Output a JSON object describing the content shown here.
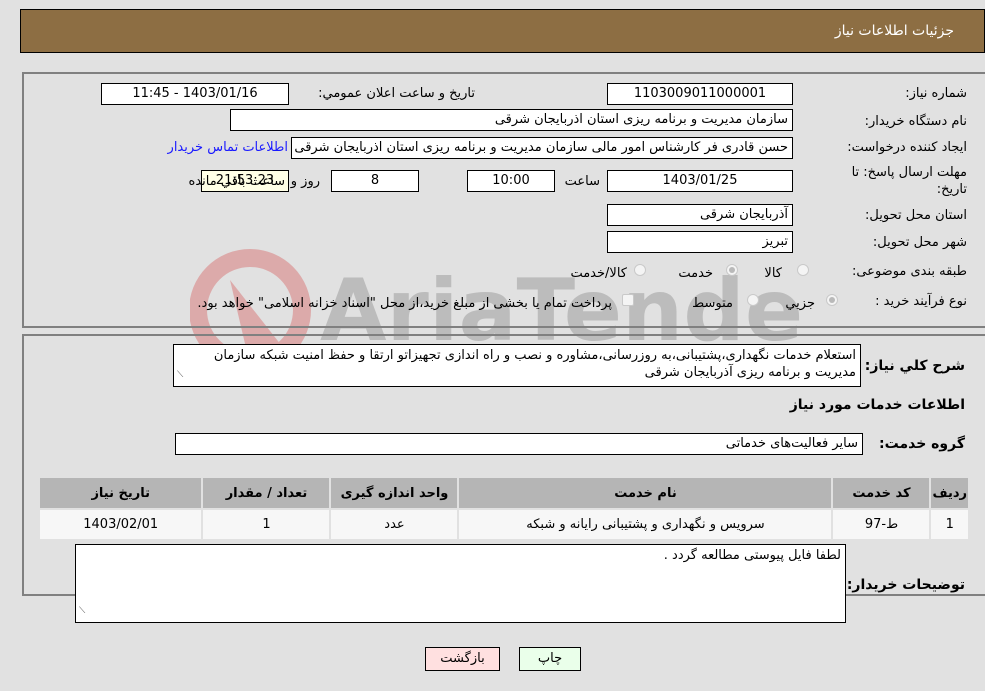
{
  "header": {
    "title": "جزئیات اطلاعات نیاز"
  },
  "fields": {
    "need_number": {
      "label": "شماره نیاز:",
      "value": "1103009011000001"
    },
    "announce_datetime": {
      "label": "تاریخ و ساعت اعلان عمومي:",
      "value": "1403/01/16 - 11:45"
    },
    "buyer_org": {
      "label": "نام دستگاه خريدار:",
      "value": "سازمان مدیریت و برنامه ریزی استان اذربایجان شرقی"
    },
    "requester": {
      "label": "ايجاد کننده درخواست:",
      "value": "حسن قادری فر کارشناس امور مالی سازمان مدیریت و برنامه ریزی استان اذربایجان شرقی"
    },
    "buyer_contact_link": "اطلاعات تماس خريدار",
    "deadline": {
      "label": "مهلت ارسال پاسخ: تا تاریخ:",
      "date": "1403/01/25",
      "time_label": "ساعت",
      "time": "10:00",
      "days": "8",
      "days_label": "روز و",
      "remaining": "21:53:23",
      "remaining_label": "ساعت باقي مانده"
    },
    "delivery_province": {
      "label": "استان محل تحویل:",
      "value": "آذربایجان شرقی"
    },
    "delivery_city": {
      "label": "شهر محل تحویل:",
      "value": "تبریز"
    },
    "category": {
      "label": "طبقه بندی موضوعی:",
      "options": [
        "کالا",
        "خدمت",
        "کالا/خدمت"
      ],
      "selected": "خدمت"
    },
    "purchase_type": {
      "label": "نوع فرآيند خريد :",
      "options": [
        "جزيي",
        "متوسط"
      ],
      "selected": "جزيي",
      "note": "پرداخت تمام یا بخشی از مبلغ خرید،از محل \"اسناد خزانه اسلامی\" خواهد بود.",
      "note_checked": false
    }
  },
  "description": {
    "label": "شرح كلي نياز:",
    "value": "استعلام خدمات نگهداری،پشتیبانی،به روزرسانی،مشاوره و نصب و راه اندازی تجهیزاتو ارتقا و حفظ امنیت شبکه سازمان مدیریت و برنامه ریزی آذربایجان شرقی"
  },
  "services_section": {
    "title": "اطلاعات خدمات مورد نياز",
    "group_label": "گروه خدمت:",
    "group_value": "سایر فعالیت‌های خدماتی",
    "table": {
      "columns": [
        "رديف",
        "کد خدمت",
        "نام خدمت",
        "واحد اندازه گيری",
        "تعداد / مقدار",
        "تاريخ نياز"
      ],
      "rows": [
        [
          "1",
          "ط-97",
          "سرویس و نگهداری و پشتیبانی رایانه و شبکه",
          "عدد",
          "1",
          "1403/02/01"
        ]
      ]
    }
  },
  "buyer_notes": {
    "label": "توضيحات خريدار:",
    "value": "لطفا فایل پیوستی مطالعه گردد ."
  },
  "buttons": {
    "print": "چاپ",
    "back": "بازگشت"
  },
  "watermark": {
    "text": "AriaTender.neT"
  },
  "colors": {
    "header_bg": "#8d6e43",
    "print_bg": "#eaffea",
    "back_bg": "#ffe0e0",
    "link": "#1a1aff"
  }
}
